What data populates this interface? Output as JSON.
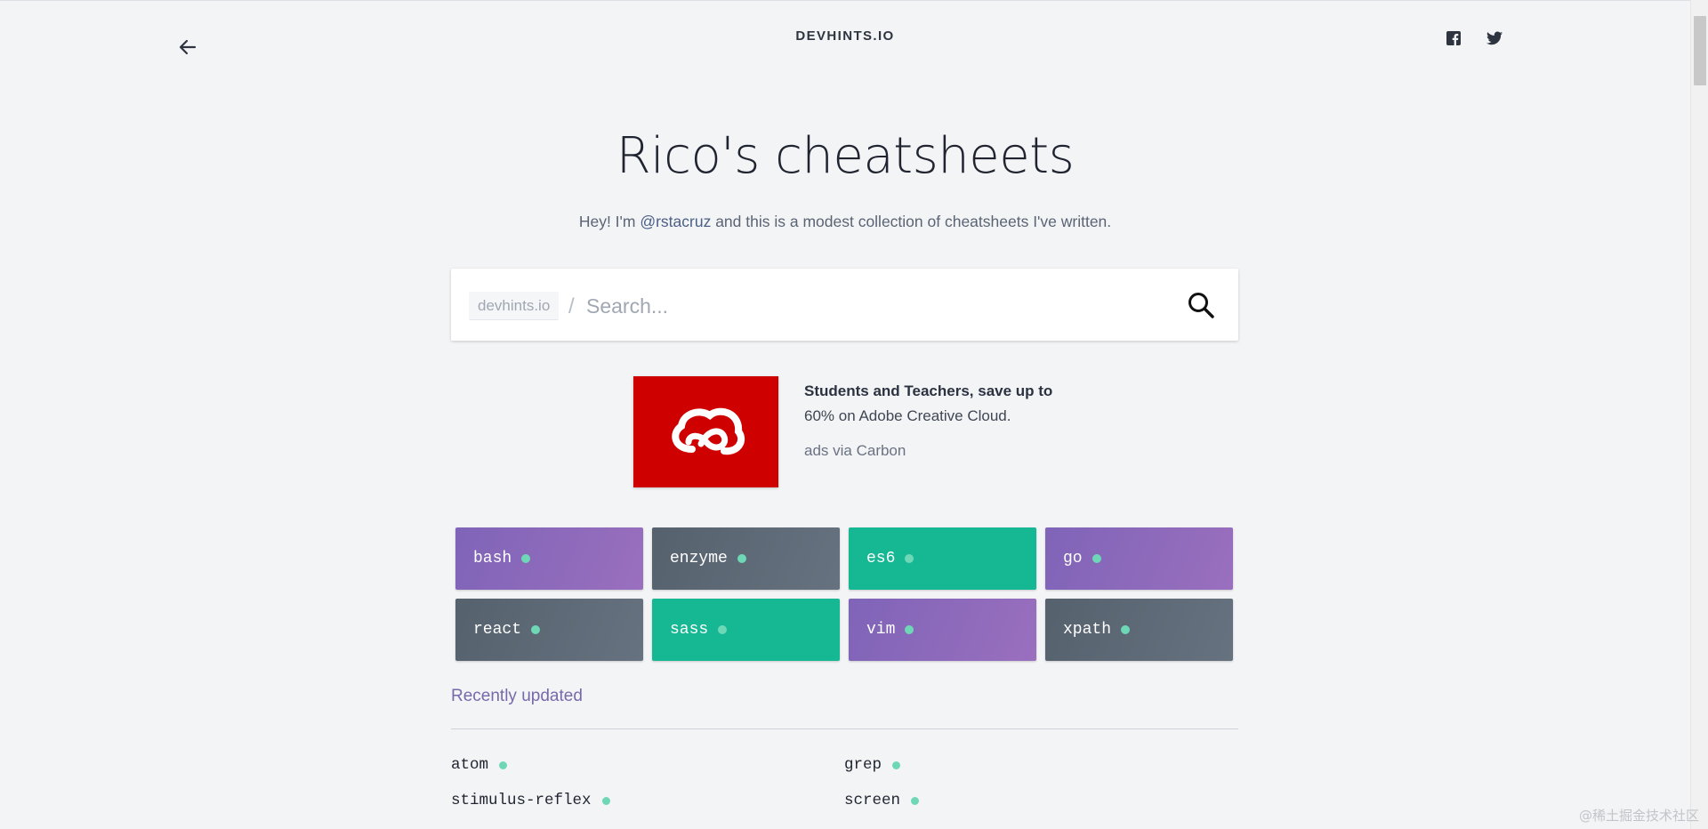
{
  "header": {
    "brand": "DEVHINTS.IO",
    "back_icon": "arrow-left-icon",
    "social_icons": [
      "facebook-icon",
      "twitter-icon"
    ]
  },
  "hero": {
    "title": "Rico's cheatsheets",
    "subtitle_pre": "Hey! I'm ",
    "subtitle_handle": "@rstacruz",
    "subtitle_post": " and this is a modest collection of cheatsheets I've written."
  },
  "search": {
    "prefix": "devhints.io",
    "separator": "/",
    "placeholder": "Search...",
    "value": "",
    "icon": "search-icon"
  },
  "ad": {
    "headline": "Students and Teachers, save up to",
    "body": "60% on Adobe Creative Cloud.",
    "via": "ads via Carbon",
    "image_icon": "adobe-creative-cloud-logo"
  },
  "featured": [
    {
      "label": "bash",
      "style": "purple"
    },
    {
      "label": "enzyme",
      "style": "slate"
    },
    {
      "label": "es6",
      "style": "green"
    },
    {
      "label": "go",
      "style": "purple"
    },
    {
      "label": "react",
      "style": "slate"
    },
    {
      "label": "sass",
      "style": "green"
    },
    {
      "label": "vim",
      "style": "purple"
    },
    {
      "label": "xpath",
      "style": "slate"
    }
  ],
  "recent": {
    "heading": "Recently updated",
    "items": [
      "atom",
      "grep",
      "stimulus-reflex",
      "screen"
    ]
  },
  "watermark": "@稀土掘金技术社区",
  "colors": {
    "background": "#f3f4f6",
    "purple_tile": "#8a69bb",
    "slate_tile": "#5e6976",
    "green_tile": "#16b793",
    "dot": "#6ed8b6",
    "heading_accent": "#7869ab",
    "ad_red": "#cf0000"
  }
}
